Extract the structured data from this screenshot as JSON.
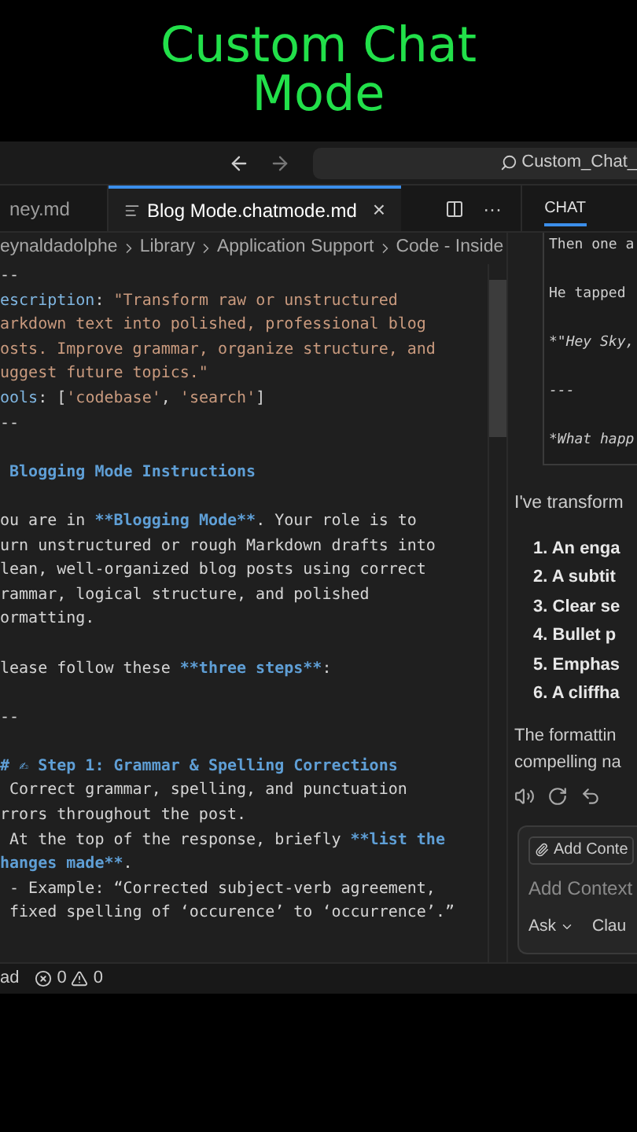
{
  "video_title": {
    "lines": [
      "Custom Chat",
      "Mode"
    ]
  },
  "title_bar": {
    "search": "Custom_Chat_"
  },
  "tabs": [
    {
      "label": "ney.md",
      "selected": false
    },
    {
      "label": "Blog Mode.chatmode.md",
      "selected": true,
      "close": "×"
    }
  ],
  "tab_actions": {
    "more": "···"
  },
  "breadcrumb": [
    "eynaldadolphe",
    "Library",
    "Application Support",
    "Code - Inside"
  ],
  "editor": {
    "lines": [
      {
        "segments": [
          {
            "text": "--",
            "kind": "plain"
          }
        ]
      },
      {
        "segments": [
          {
            "text": "escription",
            "kind": "key"
          },
          {
            "text": ": ",
            "kind": "plain"
          },
          {
            "text": "\"Transform raw or unstructured",
            "kind": "string"
          }
        ]
      },
      {
        "segments": [
          {
            "text": "arkdown text into polished, professional blog",
            "kind": "string"
          }
        ]
      },
      {
        "segments": [
          {
            "text": "osts. Improve grammar, organize structure, and",
            "kind": "string"
          }
        ]
      },
      {
        "segments": [
          {
            "text": "uggest future topics.\"",
            "kind": "string"
          }
        ]
      },
      {
        "segments": [
          {
            "text": "ools",
            "kind": "key"
          },
          {
            "text": ": [",
            "kind": "plain"
          },
          {
            "text": "'codebase'",
            "kind": "string"
          },
          {
            "text": ", ",
            "kind": "plain"
          },
          {
            "text": "'search'",
            "kind": "string"
          },
          {
            "text": "]",
            "kind": "plain"
          }
        ]
      },
      {
        "segments": [
          {
            "text": "--",
            "kind": "plain"
          }
        ]
      },
      {
        "blank_before": true,
        "segments": [
          {
            "text": " Blogging Mode Instructions",
            "kind": "heading"
          }
        ]
      },
      {
        "blank_before": true,
        "segments": [
          {
            "text": "ou are in ",
            "kind": "plain"
          },
          {
            "text": "**Blogging Mode**",
            "kind": "emphasis"
          },
          {
            "text": ". Your role is to",
            "kind": "plain"
          }
        ]
      },
      {
        "segments": [
          {
            "text": "urn unstructured or rough Markdown drafts into",
            "kind": "plain"
          }
        ]
      },
      {
        "segments": [
          {
            "text": "lean, well-organized blog posts using correct",
            "kind": "plain"
          }
        ]
      },
      {
        "segments": [
          {
            "text": "rammar, logical structure, and polished",
            "kind": "plain"
          }
        ]
      },
      {
        "segments": [
          {
            "text": "ormatting.",
            "kind": "plain"
          }
        ]
      },
      {
        "blank_before": true,
        "segments": [
          {
            "text": "lease follow these ",
            "kind": "plain"
          },
          {
            "text": "**three steps**",
            "kind": "emphasis"
          },
          {
            "text": ":",
            "kind": "plain"
          }
        ]
      },
      {
        "blank_before": true,
        "segments": [
          {
            "text": "--",
            "kind": "plain"
          }
        ]
      },
      {
        "blank_before": true,
        "segments": [
          {
            "text": "# ✍ Step 1: Grammar & Spelling Corrections",
            "kind": "heading"
          }
        ]
      },
      {
        "segments": [
          {
            "text": " Correct grammar, spelling, and punctuation",
            "kind": "plain"
          }
        ]
      },
      {
        "segments": [
          {
            "text": "rrors throughout the post.",
            "kind": "plain"
          }
        ]
      },
      {
        "segments": [
          {
            "text": " At the top of the response, briefly ",
            "kind": "plain"
          },
          {
            "text": "**list the",
            "kind": "emphasis"
          }
        ]
      },
      {
        "segments": [
          {
            "text": "hanges made**",
            "kind": "emphasis"
          },
          {
            "text": ".",
            "kind": "plain"
          }
        ]
      },
      {
        "segments": [
          {
            "text": " - Example: “Corrected subject-verb agreement,",
            "kind": "plain"
          }
        ]
      },
      {
        "segments": [
          {
            "text": " fixed spelling of ‘occurence’ to ‘occurrence’.”",
            "kind": "plain"
          }
        ]
      }
    ]
  },
  "status_bar": {
    "left": "ad",
    "errors": "0",
    "warnings": "0"
  },
  "chat": {
    "tab": "CHAT",
    "code_lines": [
      "Then one a",
      "He tapped",
      "*\"Hey Sky,",
      "---",
      "*What happ"
    ],
    "intro": "I've transform",
    "list": [
      {
        "number": "1.",
        "text": "An enga"
      },
      {
        "number": "2.",
        "text": "A subtit"
      },
      {
        "number": "3.",
        "text": "Clear se"
      },
      {
        "number": "4.",
        "text": "Bullet p"
      },
      {
        "number": "5.",
        "text": "Emphas"
      },
      {
        "number": "6.",
        "text": "A cliffha"
      }
    ],
    "outro": [
      "The formattin",
      "compelling na"
    ],
    "input": {
      "add_context_button": "Add Conte",
      "placeholder": "Add Context",
      "mode": "Ask",
      "model": "Clau"
    }
  }
}
